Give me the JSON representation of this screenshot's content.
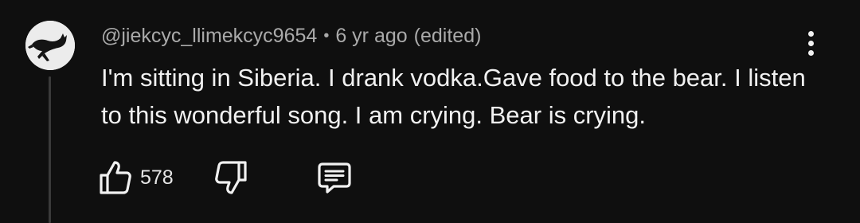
{
  "comment": {
    "author": "@jiekcyc_llimekcyc9654",
    "separator": "•",
    "time_ago": "6 yr ago",
    "edited_label": "(edited)",
    "text": "I'm sitting in Siberia. I drank vodka.Gave food to the bear. I listen to this wonderful song. I am crying. Bear is crying.",
    "like_count": "578"
  },
  "icons": {
    "avatar": "avatar-cat-silhouette",
    "more": "more-vert-icon",
    "like": "thumbs-up-icon",
    "dislike": "thumbs-down-icon",
    "reply": "comment-reply-icon"
  },
  "colors": {
    "background": "#0f0f0f",
    "text_primary": "#f1f1f1",
    "text_secondary": "#aaaaaa"
  }
}
